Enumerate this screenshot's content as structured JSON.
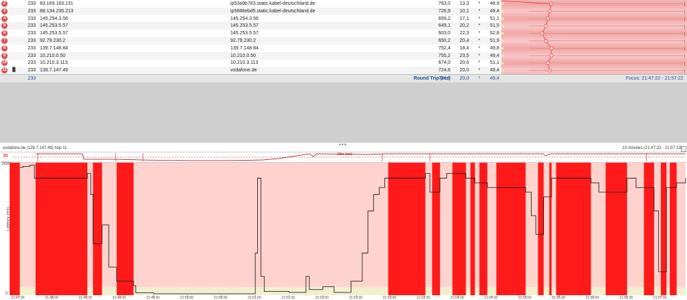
{
  "hops": [
    {
      "num": "2",
      "count": "233",
      "ip": "83.169.183.131",
      "host": "ip53a9b783.static.kabel-deutschland.de",
      "avg": "763,0",
      "pl": "13,3",
      "star": "*",
      "cur": "48,9",
      "pt": 0.27
    },
    {
      "num": "3",
      "count": "233",
      "ip": "88.134.235.213",
      "host": "ip5886ebd5.static.kabel-deutschland.de",
      "avg": "726,9",
      "pl": "10,1",
      "star": "*",
      "cur": "49,4",
      "pt": 0.26
    },
    {
      "num": "4",
      "count": "233",
      "ip": "145.254.3.56",
      "host": "145.254.3.56",
      "avg": "659,2",
      "pl": "17,1",
      "star": "*",
      "cur": "51,1",
      "pt": 0.25
    },
    {
      "num": "5",
      "count": "233",
      "ip": "145.253.5.57",
      "host": "145.253.5.57",
      "avg": "649,1",
      "pl": "20,2",
      "star": "*",
      "cur": "51,5",
      "pt": 0.24
    },
    {
      "num": "6",
      "count": "233",
      "ip": "145.253.5.57",
      "host": "145.253.5.57",
      "avg": "603,0",
      "pl": "22,3",
      "star": "*",
      "cur": "52,8",
      "pt": 0.22
    },
    {
      "num": "7",
      "count": "233",
      "ip": "92.79.230.2",
      "host": "92.79.230.2",
      "avg": "650,2",
      "pl": "20,4",
      "star": "*",
      "cur": "51,9",
      "pt": 0.24
    },
    {
      "num": "8",
      "count": "233",
      "ip": "139.7.148.84",
      "host": "139.7.148.84",
      "avg": "752,4",
      "pl": "18,4",
      "star": "*",
      "cur": "49,8",
      "pt": 0.27
    },
    {
      "num": "9",
      "count": "233",
      "ip": "10.210.0.50",
      "host": "10.210.0.50",
      "avg": "755,2",
      "pl": "23,5",
      "star": "*",
      "cur": "49,4",
      "pt": 0.27
    },
    {
      "num": "10",
      "count": "233",
      "ip": "10.210.3.113",
      "host": "10.210.3.113",
      "avg": "674,0",
      "pl": "20,6",
      "star": "*",
      "cur": "51,1",
      "pt": 0.25
    },
    {
      "num": "11",
      "count": "233",
      "ip": "139.7.147.49",
      "host": "vodafone.de",
      "avg": "724,6",
      "pl": "20,0",
      "star": "*",
      "cur": "49,4",
      "pt": 0.26
    }
  ],
  "summary": {
    "count": "233",
    "label": "Round Trip (ms)",
    "avg": "724,6",
    "pl": "20,0",
    "star": "*",
    "cur": "49,4",
    "focus": "Focus: 21:47:22 - 21:57:22"
  },
  "timeline": {
    "title": "vodafone.de (139.7.147.49) hop 11",
    "range": "10 minutes (21:47:22 - 21:57:22)",
    "jitter_max": "35",
    "jitter_label": "Jitter (ms)",
    "y_label": "Latency (ms)",
    "y_max": "2830",
    "y_min": "0",
    "x_ticks": [
      "21:47:30",
      "21:48:00",
      "21:48:30",
      "21:49:00",
      "21:49:30",
      "21:50:00",
      "21:50:30",
      "21:51:00",
      "21:51:30",
      "21:52:00",
      "21:52:30",
      "21:53:00",
      "21:53:30",
      "21:54:00",
      "21:54:30",
      "21:55:00",
      "21:55:30",
      "21:56:00",
      "21:56:30",
      "21:57:00"
    ]
  },
  "chart_data": {
    "type": "line",
    "title": "",
    "ylabel": "Latency (ms)",
    "ylim": [
      0,
      2830
    ],
    "xlim_time": [
      "21:47:22",
      "21:57:22"
    ],
    "loss_spans_time": [
      [
        "21:47:22",
        "21:47:31"
      ],
      [
        "21:47:45",
        "21:48:31"
      ],
      [
        "21:48:36",
        "21:48:44"
      ],
      [
        "21:48:57",
        "21:49:12"
      ],
      [
        "21:52:58",
        "21:53:31"
      ],
      [
        "21:53:37",
        "21:53:44"
      ],
      [
        "21:53:55",
        "21:54:07"
      ],
      [
        "21:54:11",
        "21:54:15"
      ],
      [
        "21:54:19",
        "21:54:26"
      ],
      [
        "21:54:34",
        "21:55:00"
      ],
      [
        "21:55:11",
        "21:55:16"
      ],
      [
        "21:55:21",
        "21:55:23"
      ],
      [
        "21:55:27",
        "21:55:58"
      ],
      [
        "21:56:11",
        "21:56:30"
      ],
      [
        "21:56:45",
        "21:56:54"
      ],
      [
        "21:57:00",
        "21:57:05"
      ],
      [
        "21:57:08",
        "21:57:14"
      ]
    ],
    "series": [
      {
        "values_time": [
          [
            "21:47:31",
            "2730"
          ],
          [
            "21:47:34",
            "2750"
          ],
          [
            "21:47:40",
            "2780"
          ],
          [
            "21:47:44",
            "2500"
          ],
          [
            "21:48:31",
            "2600"
          ],
          [
            "21:48:34",
            "2150"
          ],
          [
            "21:48:36",
            "1100"
          ],
          [
            "21:48:44",
            "1500"
          ],
          [
            "21:48:50",
            "600"
          ],
          [
            "21:48:57",
            "300"
          ],
          [
            "21:49:12",
            "200"
          ],
          [
            "21:49:14",
            "50"
          ],
          [
            "21:49:30",
            "30"
          ],
          [
            "21:50:00",
            "30"
          ],
          [
            "21:50:30",
            "30"
          ],
          [
            "21:50:58",
            "30"
          ],
          [
            "21:51:00",
            "900"
          ],
          [
            "21:51:02",
            "2500"
          ],
          [
            "21:51:05",
            "400"
          ],
          [
            "21:51:08",
            "80"
          ],
          [
            "21:51:30",
            "60"
          ],
          [
            "21:51:45",
            "400"
          ],
          [
            "21:51:48",
            "120"
          ],
          [
            "21:52:00",
            "180"
          ],
          [
            "21:52:10",
            "60"
          ],
          [
            "21:52:25",
            "300"
          ],
          [
            "21:52:35",
            "900"
          ],
          [
            "21:52:40",
            "1800"
          ],
          [
            "21:52:45",
            "2150"
          ],
          [
            "21:52:50",
            "2300"
          ],
          [
            "21:52:55",
            "2500"
          ],
          [
            "21:53:31",
            "2600"
          ],
          [
            "21:53:35",
            "2200"
          ],
          [
            "21:53:44",
            "2500"
          ],
          [
            "21:53:50",
            "2600"
          ],
          [
            "21:54:07",
            "2500"
          ],
          [
            "21:54:15",
            "2400"
          ],
          [
            "21:54:26",
            "2300"
          ],
          [
            "21:55:00",
            "2200"
          ],
          [
            "21:55:05",
            "1700"
          ],
          [
            "21:55:09",
            "1300"
          ],
          [
            "21:55:16",
            "2100"
          ],
          [
            "21:55:23",
            "2500"
          ],
          [
            "21:55:58",
            "2400"
          ],
          [
            "21:56:05",
            "2200"
          ],
          [
            "21:56:30",
            "2500"
          ],
          [
            "21:56:38",
            "2300"
          ],
          [
            "21:56:54",
            "1800"
          ],
          [
            "21:56:58",
            "500"
          ],
          [
            "21:57:05",
            "2300"
          ],
          [
            "21:57:14",
            "2400"
          ],
          [
            "21:57:22",
            "2500"
          ]
        ]
      }
    ]
  }
}
